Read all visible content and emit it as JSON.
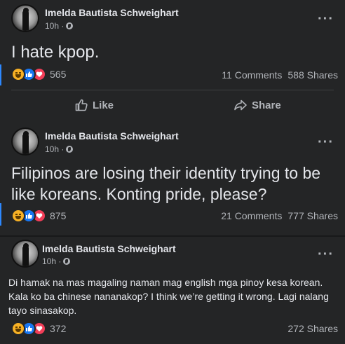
{
  "posts": [
    {
      "author": "Imelda Bautista Schweighart",
      "time": "10h ·",
      "text": "I hate kpop.",
      "reaction_count": "565",
      "comments": "11 Comments",
      "shares": "588 Shares",
      "actions": {
        "like": "Like",
        "share": "Share"
      }
    },
    {
      "author": "Imelda Bautista Schweighart",
      "time": "10h ·",
      "text": "Filipinos are losing their identity trying to be like koreans. Konting pride, please?",
      "reaction_count": "875",
      "comments": "21 Comments",
      "shares": "777 Shares"
    },
    {
      "author": "Imelda Bautista Schweighart",
      "time": "10h ·",
      "text": "Di hamak na mas magaling naman mag english mga pinoy kesa korean. Kala ko ba chinese nananakop? I think we’re getting it wrong. Lagi nalang tayo sinasakop.",
      "reaction_count": "372",
      "shares": "272 Shares"
    }
  ],
  "icons": {
    "reactions": [
      "haha-reaction-icon",
      "like-reaction-icon",
      "love-reaction-icon"
    ],
    "privacy": "globe-icon",
    "more": "more-options-icon"
  },
  "colors": {
    "background": "#18191a",
    "card": "#242526",
    "accent": "#2d88ff",
    "like": "#1877f2",
    "love": "#f33e58",
    "haha": "#f7b125"
  }
}
